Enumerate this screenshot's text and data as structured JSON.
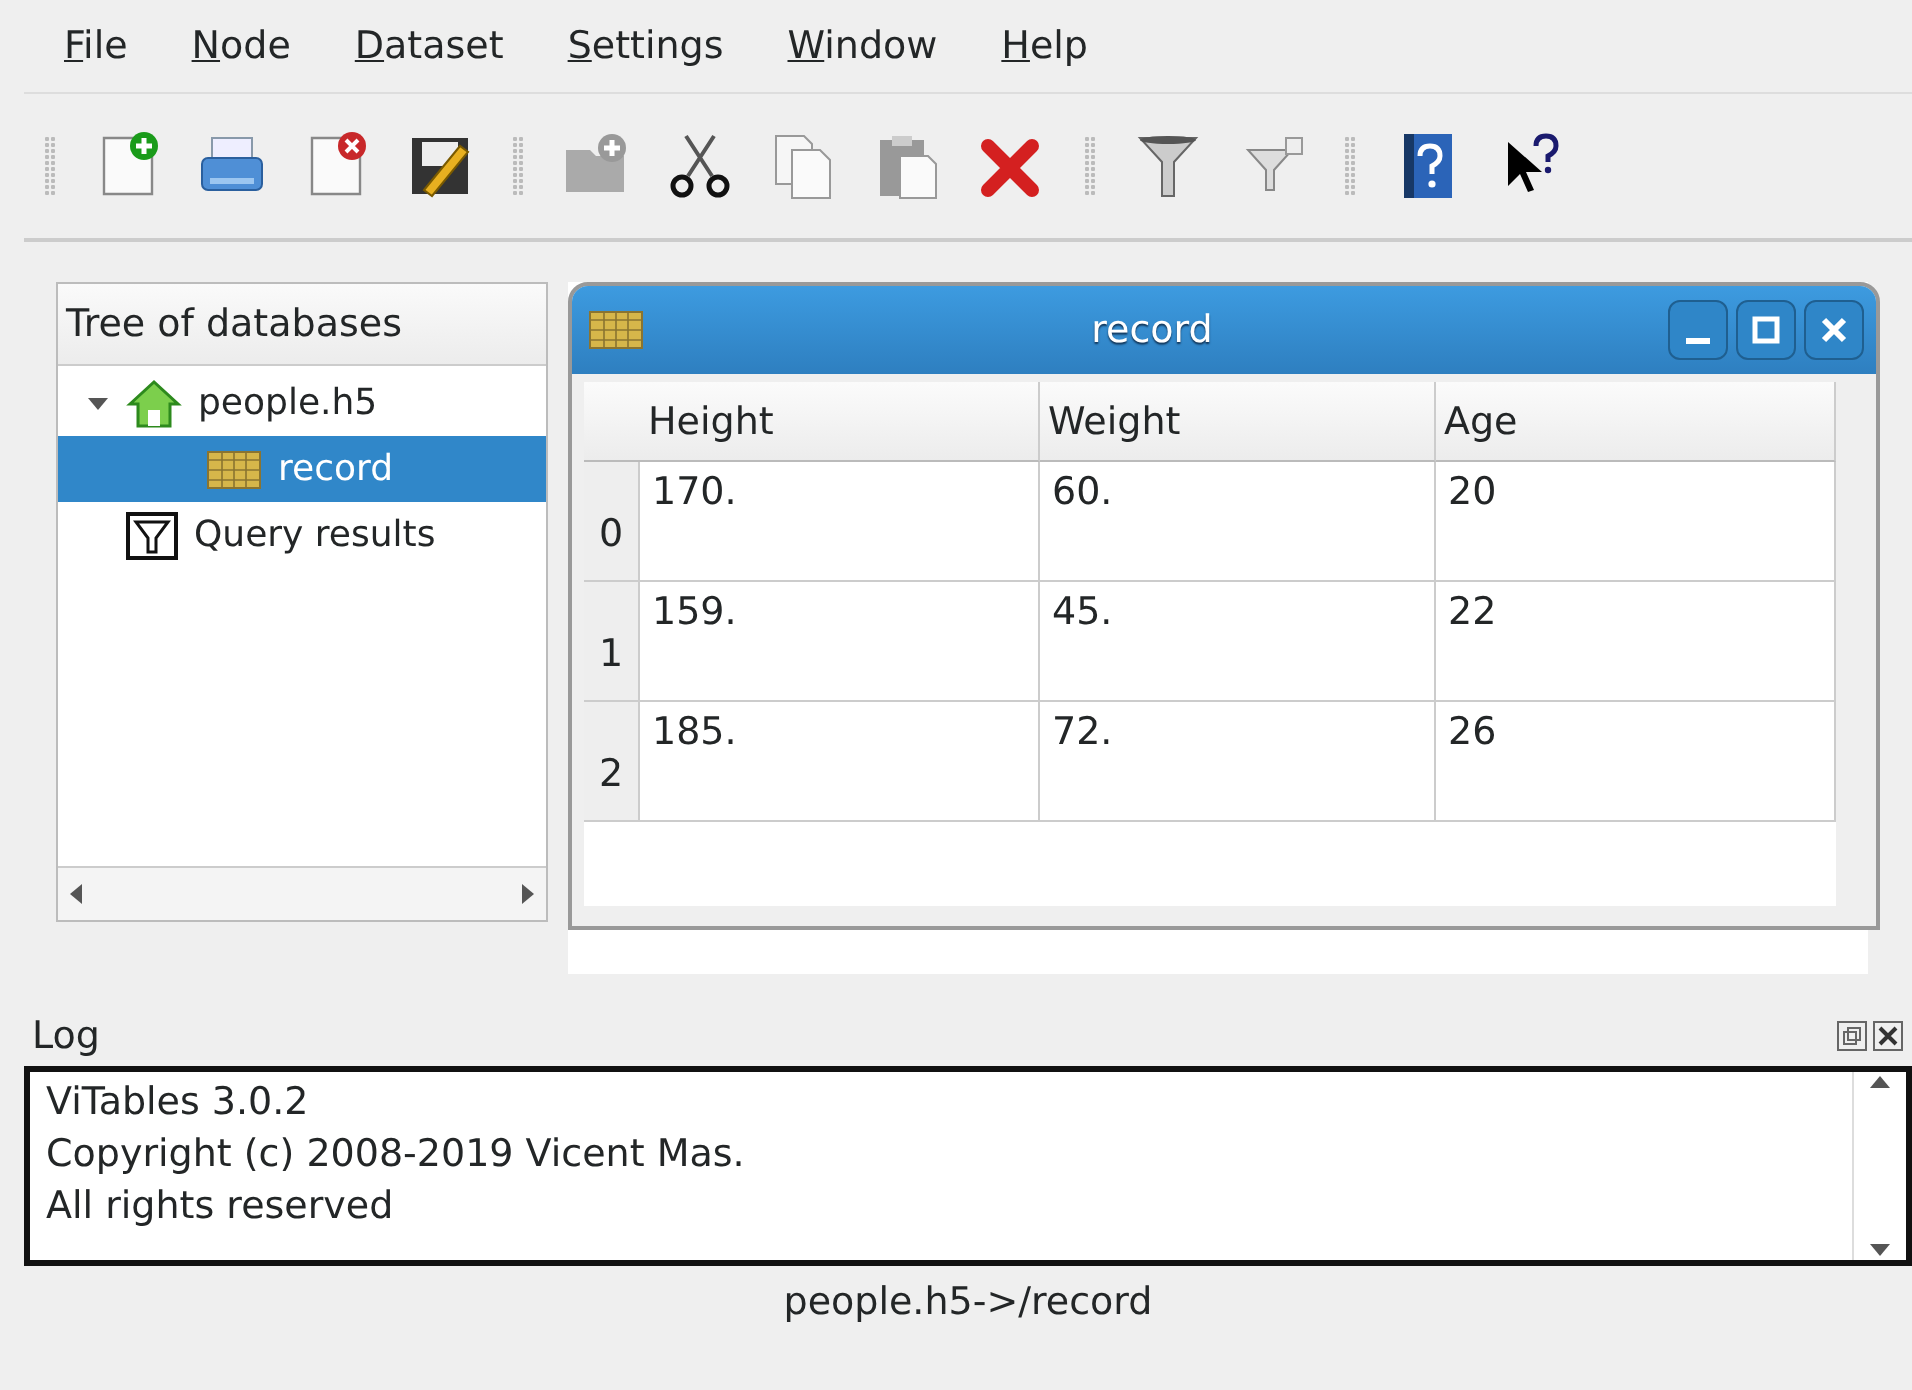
{
  "menu": [
    "File",
    "Node",
    "Dataset",
    "Settings",
    "Window",
    "Help"
  ],
  "toolbar": [
    {
      "group": [
        {
          "kind": "new-file"
        },
        {
          "kind": "open-file"
        },
        {
          "kind": "close-file"
        },
        {
          "kind": "save-as"
        }
      ]
    },
    {
      "group": [
        {
          "kind": "new-group"
        },
        {
          "kind": "cut"
        },
        {
          "kind": "copy"
        },
        {
          "kind": "paste"
        },
        {
          "kind": "delete"
        }
      ]
    },
    {
      "group": [
        {
          "kind": "query"
        },
        {
          "kind": "delete-queries"
        }
      ]
    },
    {
      "group": [
        {
          "kind": "help"
        },
        {
          "kind": "whats-this"
        }
      ]
    }
  ],
  "tree": {
    "title": "Tree of databases",
    "items": [
      {
        "label": "people.h5",
        "kind": "file",
        "expanded": true,
        "selected": false,
        "children": [
          {
            "label": "record",
            "kind": "table",
            "selected": true
          }
        ]
      },
      {
        "label": "Query results",
        "kind": "query",
        "selected": false
      }
    ]
  },
  "subwindow": {
    "title": "record",
    "columns": [
      "Height",
      "Weight",
      "Age"
    ],
    "rows": [
      {
        "index": "0",
        "cells": [
          "170.",
          "60.",
          "20"
        ]
      },
      {
        "index": "1",
        "cells": [
          "159.",
          "45.",
          "22"
        ]
      },
      {
        "index": "2",
        "cells": [
          "185.",
          "72.",
          "26"
        ]
      }
    ]
  },
  "log": {
    "title": "Log",
    "lines": [
      "ViTables 3.0.2",
      "Copyright (c) 2008-2019 Vicent Mas.",
      "All rights reserved"
    ]
  },
  "status_bar": "people.h5->/record"
}
